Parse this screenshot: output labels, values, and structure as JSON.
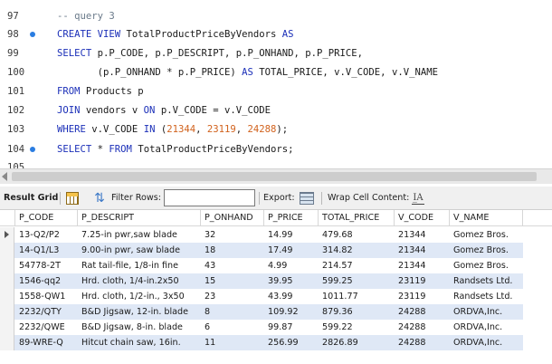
{
  "editor": {
    "lines": [
      {
        "num": "97",
        "marker": false,
        "segments": [
          {
            "t": "-- query 3",
            "c": "cm"
          }
        ]
      },
      {
        "num": "98",
        "marker": true,
        "segments": [
          {
            "t": "CREATE VIEW ",
            "c": "kw"
          },
          {
            "t": "TotalProductPriceByVendors ",
            "c": ""
          },
          {
            "t": "AS",
            "c": "kw"
          }
        ]
      },
      {
        "num": "99",
        "marker": false,
        "segments": [
          {
            "t": "SELECT ",
            "c": "kw"
          },
          {
            "t": "p.P_CODE, p.P_DESCRIPT, p.P_ONHAND, p.P_PRICE,",
            "c": ""
          }
        ]
      },
      {
        "num": "100",
        "marker": false,
        "segments": [
          {
            "t": "       (p.P_ONHAND * p.P_PRICE) ",
            "c": ""
          },
          {
            "t": "AS ",
            "c": "kw"
          },
          {
            "t": "TOTAL_PRICE, v.V_CODE, v.V_NAME",
            "c": ""
          }
        ]
      },
      {
        "num": "101",
        "marker": false,
        "segments": [
          {
            "t": "FROM ",
            "c": "kw"
          },
          {
            "t": "Products p",
            "c": ""
          }
        ]
      },
      {
        "num": "102",
        "marker": false,
        "segments": [
          {
            "t": "JOIN ",
            "c": "kw"
          },
          {
            "t": "vendors v ",
            "c": ""
          },
          {
            "t": "ON ",
            "c": "kw"
          },
          {
            "t": "p.V_CODE = v.V_CODE",
            "c": ""
          }
        ]
      },
      {
        "num": "103",
        "marker": false,
        "segments": [
          {
            "t": "WHERE ",
            "c": "kw"
          },
          {
            "t": "v.V_CODE ",
            "c": ""
          },
          {
            "t": "IN ",
            "c": "kw"
          },
          {
            "t": "(",
            "c": ""
          },
          {
            "t": "21344",
            "c": "num"
          },
          {
            "t": ", ",
            "c": ""
          },
          {
            "t": "23119",
            "c": "num"
          },
          {
            "t": ", ",
            "c": ""
          },
          {
            "t": "24288",
            "c": "num"
          },
          {
            "t": ");",
            "c": ""
          }
        ]
      },
      {
        "num": "104",
        "marker": true,
        "segments": [
          {
            "t": "SELECT ",
            "c": "kw"
          },
          {
            "t": "* ",
            "c": ""
          },
          {
            "t": "FROM ",
            "c": "kw"
          },
          {
            "t": "TotalProductPriceByVendors;",
            "c": ""
          }
        ]
      }
    ],
    "clipped_line_num": "105"
  },
  "toolbar": {
    "result_grid_label": "Result Grid",
    "filter_rows_label": "Filter Rows:",
    "filter_value": "",
    "export_label": "Export:",
    "wrap_label": "Wrap Cell Content:",
    "grid_icon": "grid-icon",
    "refresh_icon": "refresh-icon",
    "export_icon": "export-icon",
    "wrap_icon": "wrap-text-icon"
  },
  "grid": {
    "columns": [
      "P_CODE",
      "P_DESCRIPT",
      "P_ONHAND",
      "P_PRICE",
      "TOTAL_PRICE",
      "V_CODE",
      "V_NAME"
    ],
    "rows": [
      [
        "13-Q2/P2",
        "7.25-in pwr,saw blade",
        "32",
        "14.99",
        "479.68",
        "21344",
        "Gomez Bros."
      ],
      [
        "14-Q1/L3",
        "9.00-in pwr, saw blade",
        "18",
        "17.49",
        "314.82",
        "21344",
        "Gomez Bros."
      ],
      [
        "54778-2T",
        "Rat tail-file, 1/8-in fine",
        "43",
        "4.99",
        "214.57",
        "21344",
        "Gomez Bros."
      ],
      [
        "1546-qq2",
        "Hrd. cloth, 1/4-in.2x50",
        "15",
        "39.95",
        "599.25",
        "23119",
        "Randsets Ltd."
      ],
      [
        "1558-QW1",
        "Hrd. cloth, 1/2-in., 3x50",
        "23",
        "43.99",
        "1011.77",
        "23119",
        "Randsets Ltd."
      ],
      [
        "2232/QTY",
        "B&D Jigsaw, 12-in. blade",
        "8",
        "109.92",
        "879.36",
        "24288",
        "ORDVA,Inc."
      ],
      [
        "2232/QWE",
        "B&D Jigsaw, 8-in. blade",
        "6",
        "99.87",
        "599.22",
        "24288",
        "ORDVA,Inc."
      ],
      [
        "89-WRE-Q",
        "Hitcut chain saw, 16in.",
        "11",
        "256.99",
        "2826.89",
        "24288",
        "ORDVA,Inc."
      ]
    ]
  }
}
